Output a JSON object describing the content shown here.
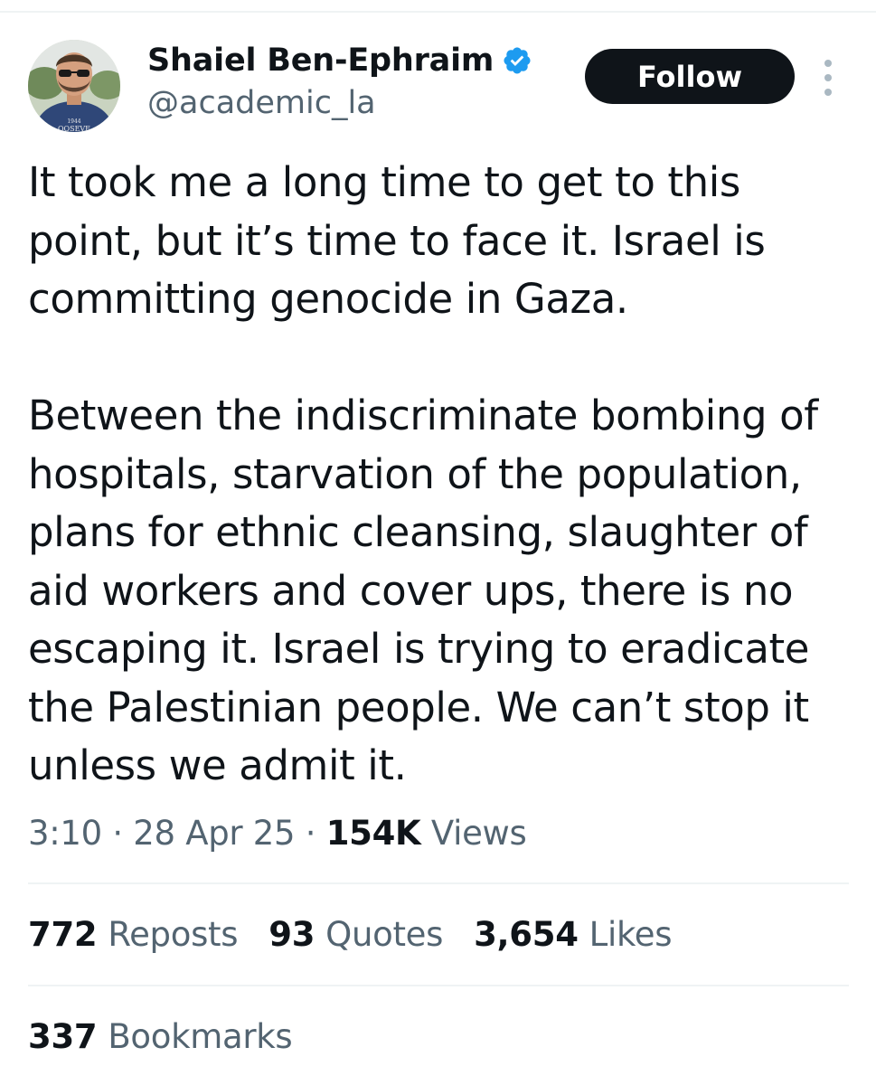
{
  "author": {
    "display_name": "Shaiel Ben-Ephraim",
    "handle": "@academic_la",
    "verified": true,
    "avatar_shirt_text": [
      "1944",
      "OOSEVE"
    ]
  },
  "follow_button": {
    "label": "Follow"
  },
  "tweet": {
    "paragraphs": [
      [
        "It took me a long time to get to this",
        "point, but it’s time to face it. Israel is",
        "committing genocide in Gaza."
      ],
      [
        "Between the indiscriminate bombing of",
        "hospitals, starvation of the population,",
        "plans for ethnic cleansing, slaughter of",
        "aid workers and cover ups, there is no",
        "escaping it. Israel is trying to eradicate",
        "the Palestinian people. We can’t stop it",
        "unless we admit it."
      ]
    ]
  },
  "meta": {
    "time": "3:10",
    "separator": "·",
    "date": "28 Apr 25",
    "views_count": "154K",
    "views_label": "Views"
  },
  "stats": {
    "reposts_count": "772",
    "reposts_label": "Reposts",
    "quotes_count": "93",
    "quotes_label": "Quotes",
    "likes_count": "3,654",
    "likes_label": "Likes",
    "bookmarks_count": "337",
    "bookmarks_label": "Bookmarks"
  },
  "colors": {
    "text_primary": "#0f1419",
    "text_secondary": "#536471",
    "verified_blue": "#1d9bf0",
    "follow_bg": "#0f1419",
    "divider": "#eff3f4"
  },
  "icons": {
    "verified": "verified-badge-icon",
    "more": "more-vertical-icon"
  }
}
